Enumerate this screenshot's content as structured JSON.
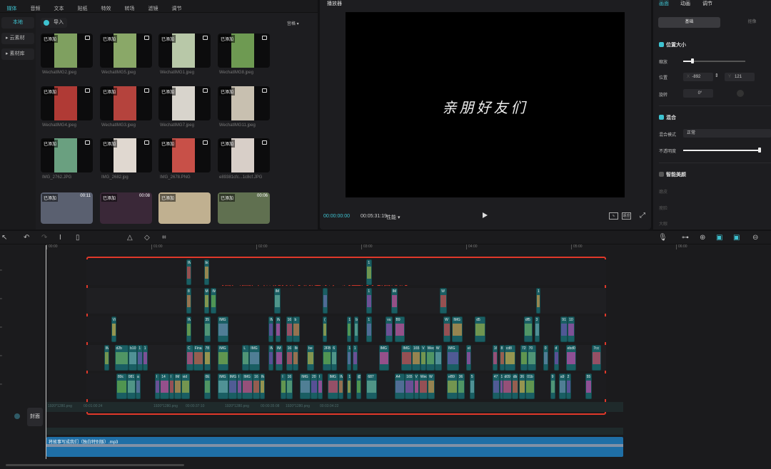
{
  "top_nav": [
    {
      "label": "媒体",
      "active": true
    },
    {
      "label": "音频"
    },
    {
      "label": "文本"
    },
    {
      "label": "贴纸"
    },
    {
      "label": "特效"
    },
    {
      "label": "转场"
    },
    {
      "label": "滤镜"
    },
    {
      "label": "调节"
    }
  ],
  "sidebar": [
    {
      "label": "本地",
      "active": true
    },
    {
      "label": "▸ 云素材"
    },
    {
      "label": "▸ 素材库"
    }
  ],
  "media": {
    "import_label": "导入",
    "view_label": "宫格 ▾",
    "added_badge": "已添加",
    "items": [
      {
        "name": "WechatIMG2.jpeg",
        "color": "#7fa060"
      },
      {
        "name": "WechatIMG5.jpeg",
        "color": "#8aa868"
      },
      {
        "name": "WechatIMG1.jpeg",
        "color": "#b8c8a8"
      },
      {
        "name": "WechatIMG8.jpeg",
        "color": "#6e9a52"
      },
      {
        "name": "WechatIMG4.jpeg",
        "color": "#b03a35"
      },
      {
        "name": "WechatIMG3.jpeg",
        "color": "#b5433d"
      },
      {
        "name": "WechatIMG7.jpeg",
        "color": "#d8d4cc"
      },
      {
        "name": "WechatIMG11.jpeg",
        "color": "#c8c0b0"
      },
      {
        "name": "IMG_2762.JPG",
        "color": "#6aa080"
      },
      {
        "name": "IMG_2682.jpg",
        "color": "#e0d8d0"
      },
      {
        "name": "IMG_2678.PNG",
        "color": "#c85048"
      },
      {
        "name": "e89381cfc...1c8cf.JPG",
        "color": "#d8cfc8"
      },
      {
        "name": "",
        "color": "#5a6070",
        "duration": "00:11",
        "wide": true
      },
      {
        "name": "",
        "color": "#3a2838",
        "duration": "00:08",
        "wide": true
      },
      {
        "name": "",
        "color": "#c0b090",
        "wide": true
      },
      {
        "name": "",
        "color": "#607050",
        "duration": "00:06",
        "wide": true
      }
    ]
  },
  "player": {
    "title": "播放器",
    "caption": "亲朋好友们",
    "current_time": "00:00:00:00",
    "total_time": "00:05:31:19",
    "perf_label": "性能 ▾",
    "ratio_label": "适应"
  },
  "inspector": {
    "tabs": [
      "画面",
      "动画",
      "调节"
    ],
    "segments": [
      "基础",
      "抠像"
    ],
    "pos_size": "位置大小",
    "scale": "缩放",
    "scale_value": 0.15,
    "position": "位置",
    "x_label": "X",
    "x_value": "-892",
    "y_label": "Y",
    "y_value": "121",
    "rotate": "旋转",
    "rotate_value": "0°",
    "blend": "混合",
    "blend_mode_label": "混合模式",
    "blend_mode": "正常",
    "opacity_label": "不透明度",
    "opacity_value": 1.0,
    "beauty": "智能美颜",
    "beauty_items": [
      "磨皮",
      "瘦脸",
      "大眼"
    ]
  },
  "timeline": {
    "ruler": [
      "00:00",
      "01:00",
      "02:00",
      "03:00",
      "04:00",
      "05:00",
      "06:00"
    ],
    "annotation": "插入图片和视频到轨道条，调整好先后顺序",
    "cover_label": "封面",
    "audio_label": "将故事写成我们（独白特别版）.mp3",
    "main_track_labels": [
      "1920*1280.png",
      "00:01:00:24",
      "1920*1280.png",
      "00:00:37:10",
      "1920*1280.png",
      "00:00:35:08",
      "1920*1280.png",
      "00:03:04:22"
    ],
    "tracks": [
      [
        [
          80,
          3,
          "IM"
        ],
        [
          90,
          3,
          "bo"
        ],
        [
          183,
          3,
          "1"
        ]
      ],
      [
        [
          80,
          3,
          "8"
        ],
        [
          90,
          3,
          "M"
        ],
        [
          94,
          3,
          "IM"
        ],
        [
          130,
          4,
          "IM"
        ],
        [
          158,
          3,
          ""
        ],
        [
          183,
          3,
          "1"
        ],
        [
          197,
          4,
          "IM"
        ],
        [
          225,
          4,
          "W"
        ],
        [
          280,
          2,
          "1"
        ]
      ],
      [
        [
          37,
          3,
          "Vi"
        ],
        [
          80,
          3,
          "IM"
        ],
        [
          90,
          4,
          "35"
        ],
        [
          98,
          6,
          "IMG"
        ],
        [
          127,
          3,
          "IM"
        ],
        [
          131,
          3,
          "IM"
        ],
        [
          137,
          4,
          "16"
        ],
        [
          141,
          4,
          "b"
        ],
        [
          158,
          2,
          "("
        ],
        [
          172,
          2,
          "1"
        ],
        [
          176,
          2,
          "b"
        ],
        [
          183,
          3,
          "1"
        ],
        [
          194,
          4,
          "vu"
        ],
        [
          199,
          6,
          "B9"
        ],
        [
          227,
          4,
          "W"
        ],
        [
          232,
          6,
          "IMG"
        ],
        [
          245,
          6,
          "d5"
        ],
        [
          273,
          5,
          "df5"
        ],
        [
          279,
          3,
          "3"
        ],
        [
          294,
          4,
          "91"
        ],
        [
          298,
          4,
          "10"
        ]
      ],
      [
        [
          33,
          3,
          "IM"
        ],
        [
          39,
          8,
          "d2b"
        ],
        [
          47,
          5,
          "b10"
        ],
        [
          52,
          3,
          "1"
        ],
        [
          55,
          3,
          "1"
        ],
        [
          80,
          4,
          "C"
        ],
        [
          84,
          6,
          "Fina"
        ],
        [
          90,
          4,
          "78"
        ],
        [
          98,
          6,
          "IMG"
        ],
        [
          112,
          4,
          "L"
        ],
        [
          116,
          6,
          "IMG"
        ],
        [
          127,
          3,
          "IM"
        ],
        [
          131,
          4,
          "IM"
        ],
        [
          137,
          4,
          "16"
        ],
        [
          141,
          3,
          "IM"
        ],
        [
          149,
          4,
          "be"
        ],
        [
          158,
          5,
          "2FB"
        ],
        [
          163,
          3,
          "6"
        ],
        [
          172,
          2,
          "1"
        ],
        [
          175,
          3,
          "1"
        ],
        [
          190,
          6,
          "IMG"
        ],
        [
          203,
          6,
          "IMG"
        ],
        [
          209,
          5,
          "165"
        ],
        [
          214,
          3,
          "V"
        ],
        [
          217,
          5,
          "Wec"
        ],
        [
          222,
          4,
          "W"
        ],
        [
          229,
          7,
          "IMG"
        ],
        [
          240,
          3,
          "el"
        ],
        [
          255,
          3,
          "16"
        ],
        [
          259,
          3,
          "8"
        ],
        [
          262,
          6,
          "cd8"
        ],
        [
          271,
          4,
          "72"
        ],
        [
          275,
          5,
          "70"
        ],
        [
          284,
          3,
          "0"
        ],
        [
          290,
          3,
          "d"
        ],
        [
          297,
          6,
          "ebd0"
        ],
        [
          312,
          5,
          "7cc"
        ]
      ],
      [
        [
          40,
          6,
          "80c"
        ],
        [
          46,
          5,
          "081"
        ],
        [
          51,
          3,
          "a"
        ],
        [
          62,
          3,
          "I"
        ],
        [
          65,
          5,
          "14"
        ],
        [
          70,
          3,
          "I"
        ],
        [
          73,
          4,
          "IM"
        ],
        [
          77,
          5,
          "vid"
        ],
        [
          90,
          4,
          "0E"
        ],
        [
          98,
          6,
          "IMG"
        ],
        [
          104,
          5,
          "IMG"
        ],
        [
          109,
          3,
          "I"
        ],
        [
          112,
          6,
          "IMG"
        ],
        [
          118,
          4,
          "16"
        ],
        [
          122,
          3,
          "IM"
        ],
        [
          134,
          3,
          "I"
        ],
        [
          137,
          4,
          "16"
        ],
        [
          145,
          6,
          "IMG"
        ],
        [
          151,
          4,
          "20"
        ],
        [
          155,
          3,
          "I"
        ],
        [
          161,
          6,
          "IMG"
        ],
        [
          167,
          3,
          "IM"
        ],
        [
          172,
          2,
          "1"
        ],
        [
          177,
          3,
          "@"
        ],
        [
          183,
          6,
          "687"
        ],
        [
          199,
          6,
          "A4"
        ],
        [
          205,
          5,
          "165"
        ],
        [
          210,
          3,
          "V"
        ],
        [
          213,
          5,
          "Wec"
        ],
        [
          218,
          4,
          "W"
        ],
        [
          229,
          6,
          "eB9"
        ],
        [
          235,
          4,
          "36"
        ],
        [
          242,
          3,
          "5"
        ],
        [
          255,
          4,
          "47"
        ],
        [
          259,
          2,
          "1"
        ],
        [
          261,
          5,
          "d09"
        ],
        [
          266,
          4,
          "db"
        ],
        [
          270,
          4,
          "36"
        ],
        [
          274,
          5,
          "01b"
        ],
        [
          288,
          3,
          "9"
        ],
        [
          293,
          4,
          "a9"
        ],
        [
          297,
          3,
          "2"
        ],
        [
          308,
          4,
          "55"
        ]
      ]
    ]
  },
  "colors": {
    "accent": "#3ec3d1",
    "clip": "#1a5e63",
    "audio": "#1f6fa6",
    "annotation": "#e0382a"
  }
}
